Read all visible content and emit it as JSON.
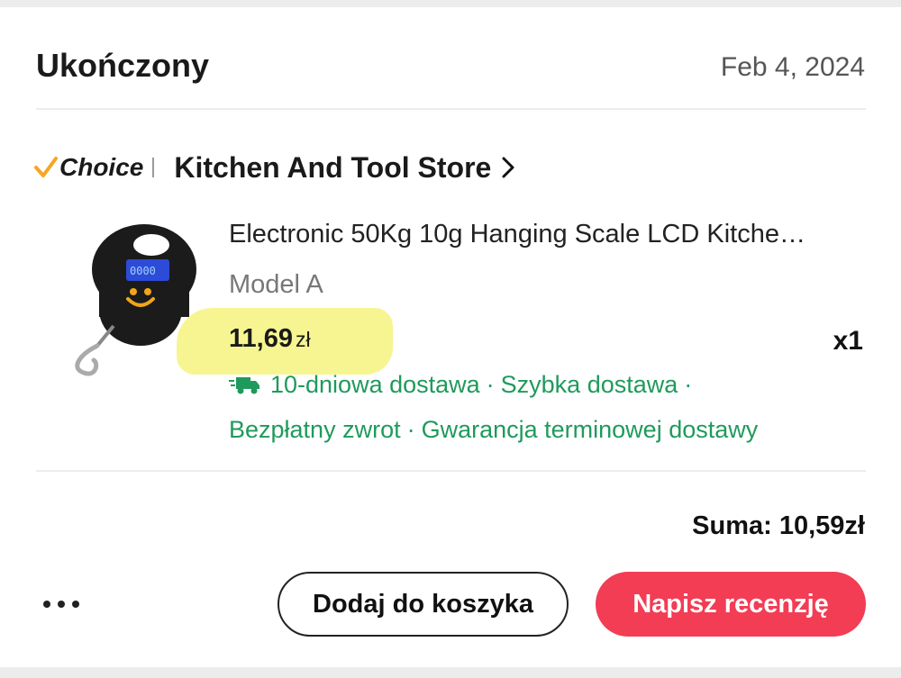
{
  "order": {
    "status": "Ukończony",
    "date": "Feb 4, 2024"
  },
  "store": {
    "badge": "Choice",
    "name": "Kitchen And Tool Store",
    "badge_color": "#f5a623"
  },
  "item": {
    "title": "Electronic 50Kg 10g Hanging Scale LCD Kitche…",
    "variant": "Model A",
    "price": "11,69",
    "currency": "zł",
    "quantity": "x1",
    "thumbnail_icon": "hanging-scale-product-image"
  },
  "shipping": {
    "delivery": "10-dniowa dostawa",
    "fast": "Szybka dostawa",
    "dot": "·",
    "free_return": "Bezpłatny zwrot",
    "guarantee": "Gwarancja terminowej dostawy",
    "color": "#1f9a5c"
  },
  "summary": {
    "total": "Suma: 10,59zł"
  },
  "actions": {
    "more_icon": "more-horizontal-icon",
    "add_to_cart": "Dodaj do koszyka",
    "write_review": "Napisz recenzję",
    "accent": "#f23d55"
  }
}
